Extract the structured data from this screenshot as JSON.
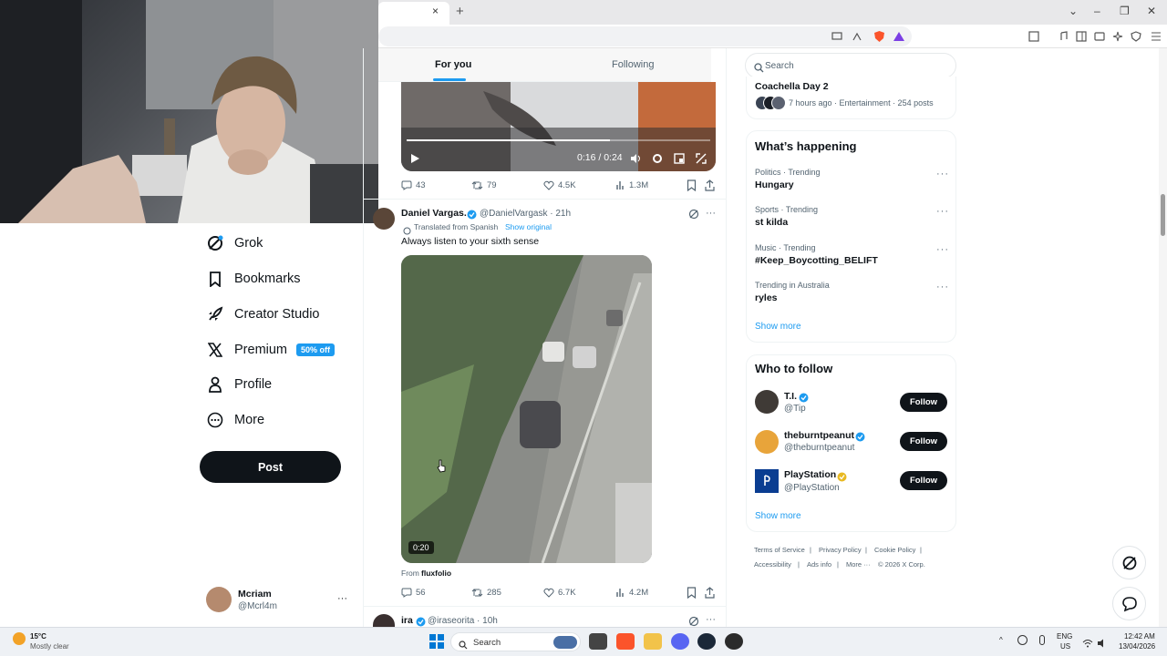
{
  "browser": {
    "tab_close": "×",
    "tab_new": "+",
    "win_min": "⌄",
    "win_restore": "–",
    "win_max": "❐",
    "win_close": "✕"
  },
  "feed_tabs": {
    "for_you": "For you",
    "following": "Following"
  },
  "video1": {
    "time": "0:16 / 0:24",
    "progress": 0.67
  },
  "post1_actions": {
    "replies": "43",
    "reposts": "79",
    "likes": "4.5K",
    "views": "1.3M"
  },
  "post2": {
    "author": "Daniel Vargas.",
    "handle_time": "@DanielVargask · 21h",
    "translated": "Translated from Spanish",
    "show_original": "Show original",
    "text": "Always listen to your sixth sense",
    "duration": "0:20",
    "from_label": "From",
    "from_name": "fluxfolio",
    "replies": "56",
    "reposts": "285",
    "likes": "6.7K",
    "views": "4.2M"
  },
  "post3": {
    "author": "ira",
    "handle_time": "@iraseorita · 10h"
  },
  "nav": {
    "grok": "Grok",
    "bookmarks": "Bookmarks",
    "creator_studio": "Creator Studio",
    "premium": "Premium",
    "premium_badge": "50% off",
    "profile": "Profile",
    "more": "More",
    "post": "Post",
    "user_name": "Mcriam",
    "user_handle": "@Mcrl4m",
    "user_more": "···"
  },
  "search": {
    "placeholder": "Search"
  },
  "coachella": {
    "title": "Coachella Day 2",
    "meta": "7 hours ago · Entertainment · 254 posts"
  },
  "happening": {
    "title": "What’s happening",
    "trends": [
      {
        "meta": "Politics · Trending",
        "name": "Hungary"
      },
      {
        "meta": "Sports · Trending",
        "name": "st kilda"
      },
      {
        "meta": "Music · Trending",
        "name": "#Keep_Boycotting_BELIFT"
      },
      {
        "meta": "Trending in Australia",
        "name": "ryles"
      }
    ],
    "show_more": "Show more"
  },
  "who_to_follow": {
    "title": "Who to follow",
    "accounts": [
      {
        "name": "T.I.",
        "handle": "@Tip",
        "button": "Follow"
      },
      {
        "name": "theburntpeanut",
        "handle": "@theburntpeanut",
        "button": "Follow"
      },
      {
        "name": "PlayStation",
        "handle": "@PlayStation",
        "button": "Follow"
      }
    ],
    "show_more": "Show more"
  },
  "footer": {
    "terms": "Terms of Service",
    "privacy": "Privacy Policy",
    "cookie": "Cookie Policy",
    "accessibility": "Accessibility",
    "ads": "Ads info",
    "more": "More ···",
    "copyright": "© 2026 X Corp."
  },
  "taskbar": {
    "weather_temp": "15°C",
    "weather_desc": "Mostly clear",
    "search": "Search",
    "lang1": "ENG",
    "lang2": "US",
    "time": "12:42 AM",
    "date": "13/04/2026"
  },
  "colors": {
    "accent": "#1d9bf0",
    "text": "#0f1419",
    "muted": "#536471",
    "gold": "#e8b923"
  }
}
